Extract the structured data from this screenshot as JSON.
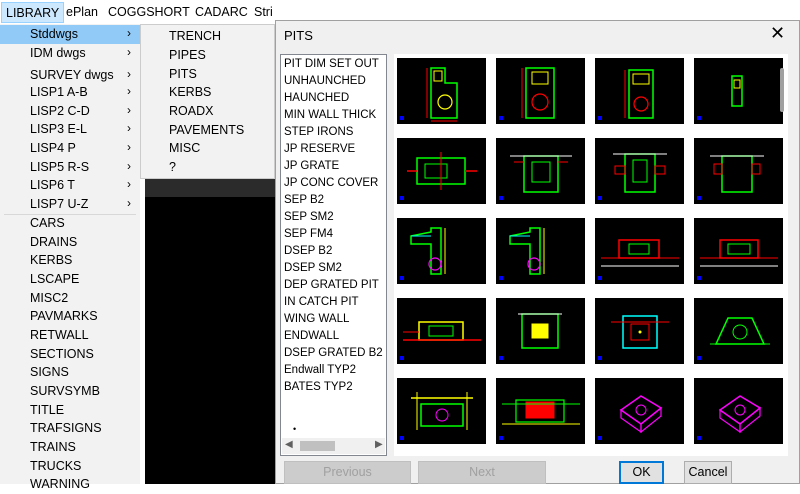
{
  "menubar": {
    "items": [
      "LIBRARY",
      "ePlan",
      "COGGSHORT",
      "CADARC",
      "Stri"
    ]
  },
  "library_menu": {
    "items": [
      {
        "label": "Stddwgs",
        "submenu": true,
        "highlighted": true
      },
      {
        "label": "IDM dwgs",
        "submenu": true
      },
      {
        "label": "SURVEY dwgs",
        "submenu": true
      },
      {
        "label": "LISP1 A-B",
        "submenu": true
      },
      {
        "label": "LISP2 C-D",
        "submenu": true
      },
      {
        "label": "LISP3 E-L",
        "submenu": true
      },
      {
        "label": "LISP4 P",
        "submenu": true
      },
      {
        "label": "LISP5 R-S",
        "submenu": true
      },
      {
        "label": "LISP6 T",
        "submenu": true
      },
      {
        "label": "LISP7 U-Z",
        "submenu": true
      },
      {
        "label": "CARS"
      },
      {
        "label": "DRAINS"
      },
      {
        "label": "KERBS"
      },
      {
        "label": "LSCAPE"
      },
      {
        "label": "MISC2"
      },
      {
        "label": "PAVMARKS"
      },
      {
        "label": "RETWALL"
      },
      {
        "label": "SECTIONS"
      },
      {
        "label": "SIGNS"
      },
      {
        "label": "SURVSYMB"
      },
      {
        "label": "TITLE"
      },
      {
        "label": "TRAFSIGNS"
      },
      {
        "label": "TRAINS"
      },
      {
        "label": "TRUCKS"
      },
      {
        "label": "WARNING"
      }
    ],
    "arrow_glyph": "›"
  },
  "stddwgs_submenu": {
    "items": [
      "TRENCH",
      "PIPES",
      "PITS",
      "KERBS",
      "ROADX",
      "PAVEMENTS",
      "MISC",
      "?"
    ]
  },
  "dialog": {
    "title": "PITS",
    "close_glyph": "✕",
    "list_items": [
      "PIT DIM  SET OUT",
      "UNHAUNCHED",
      "HAUNCHED",
      "MIN WALL THICK",
      "STEP IRONS",
      "JP RESERVE",
      "JP GRATE",
      "JP CONC COVER",
      "SEP B2",
      "SEP SM2",
      "SEP FM4",
      "DSEP B2",
      "DSEP SM2",
      "DEP GRATED PIT",
      "IN CATCH PIT",
      "WING WALL",
      "ENDWALL",
      "DSEP GRATED B2",
      "Endwall TYP2",
      "BATES TYP2"
    ],
    "list_cursor": "•",
    "scroll_left": "◀",
    "scroll_right": "▶",
    "buttons": {
      "previous": "Previous",
      "next": "Next",
      "ok": "OK",
      "cancel": "Cancel"
    },
    "colors": {
      "green": "#00ff00",
      "yellow": "#ffff00",
      "red": "#ff0000",
      "cyan": "#00ffff",
      "magenta": "#ff00ff",
      "blue": "#0000ff",
      "white": "#ffffff"
    }
  }
}
